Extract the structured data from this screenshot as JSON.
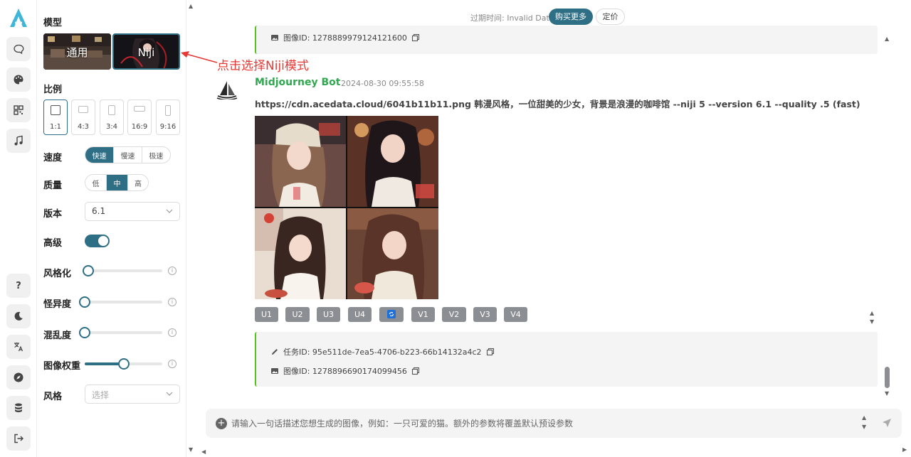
{
  "sidebar": {
    "items": [
      {
        "icon": "chat-icon"
      },
      {
        "icon": "palette-icon"
      },
      {
        "icon": "qrcode-icon"
      },
      {
        "icon": "music-icon"
      },
      {
        "icon": "help-icon",
        "label": "?"
      },
      {
        "icon": "moon-icon"
      },
      {
        "icon": "translate-icon"
      },
      {
        "icon": "compass-icon"
      },
      {
        "icon": "database-icon"
      },
      {
        "icon": "logout-icon"
      }
    ]
  },
  "settings": {
    "model_label": "模型",
    "models": [
      {
        "label": "通用",
        "selected": false
      },
      {
        "label": "Niji",
        "selected": true
      }
    ],
    "annotation": "点击选择Niji模式",
    "ratio_label": "比例",
    "ratios": [
      {
        "label": "1:1",
        "selected": true
      },
      {
        "label": "4:3",
        "selected": false
      },
      {
        "label": "3:4",
        "selected": false
      },
      {
        "label": "16:9",
        "selected": false
      },
      {
        "label": "9:16",
        "selected": false
      }
    ],
    "speed_label": "速度",
    "speed_options": [
      "快速",
      "慢速",
      "极速"
    ],
    "speed_selected": "快速",
    "quality_label": "质量",
    "quality_options": [
      "低",
      "中",
      "高"
    ],
    "quality_selected": "中",
    "version_label": "版本",
    "version_value": "6.1",
    "advanced_label": "高级",
    "advanced_on": true,
    "stylize_label": "风格化",
    "stylize_level": 0.05,
    "weird_label": "怪异度",
    "weird_level": 0.0,
    "chaos_label": "混乱度",
    "chaos_level": 0.0,
    "image_weight_label": "图像权重",
    "image_weight_level": 0.5,
    "style_label": "风格",
    "style_placeholder": "选择",
    "info_glyph": "i"
  },
  "header": {
    "expire_text": "过期时间: Invalid Date",
    "buy_button": "购买更多",
    "price_button": "定价"
  },
  "chat": {
    "prev_image_id": "图像ID: 1278889979124121600",
    "bot_name": "Midjourney Bot",
    "timestamp": "2024-08-30 09:55:58",
    "prompt": "https://cdn.acedata.cloud/6041b11b11.png 韩漫风格，一位甜美的少女，背景是浪漫的咖啡馆 --niji 5 --version 6.1 --quality .5 (fast)",
    "actions": [
      "U1",
      "U2",
      "U3",
      "U4",
      "V1",
      "V2",
      "V3",
      "V4"
    ],
    "task_id": "任务ID: 95e511de-7ea5-4706-b223-66b14132a4c2",
    "image_id": "图像ID: 1278896690174099456"
  },
  "input": {
    "placeholder": "请输入一句话描述您想生成的图像，例如：一只可爱的猫。额外的参数将覆盖默认预设参数"
  },
  "colors": {
    "accent": "#2f6f86",
    "bot_green": "#2fa84f",
    "annotation_red": "#e53935"
  }
}
